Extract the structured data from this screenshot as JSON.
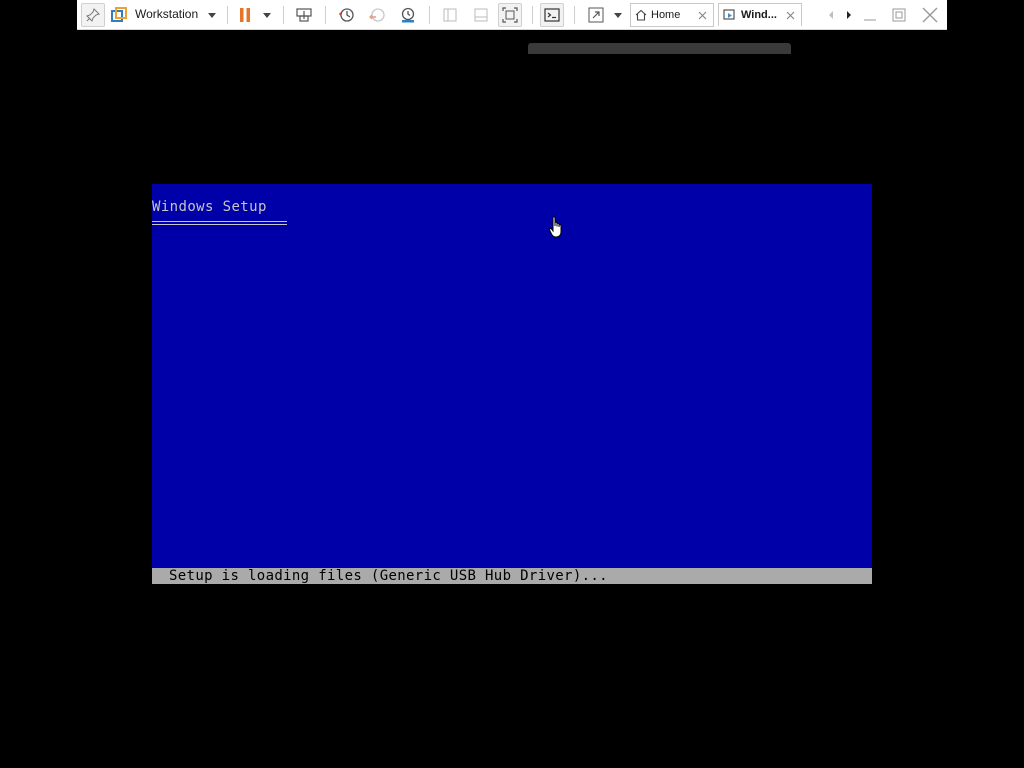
{
  "toolbar": {
    "workstation_label": "Workstation",
    "icons": {
      "pin": "pin-icon",
      "vmware_logo": "vmware-logo-icon",
      "pause": "pause-icon",
      "send_keys": "send-keys-icon",
      "snapshot": "snapshot-icon",
      "revert_snapshot": "revert-snapshot-icon",
      "snapshot_manager": "snapshot-manager-icon",
      "library": "library-icon",
      "thumbnail_bar": "thumbnail-bar-icon",
      "fit_guest": "fit-guest-icon",
      "console": "console-icon",
      "fullscreen": "fullscreen-icon"
    },
    "colors": {
      "pause": "#e8742a",
      "vmware_logo": "#2e7fc1",
      "tab_icon": "#3c8fd0"
    }
  },
  "tabs": [
    {
      "label": "Home",
      "icon": "home-icon",
      "active": false
    },
    {
      "label": "Wind...",
      "icon": "vm-icon",
      "active": true
    }
  ],
  "guest": {
    "title": "Windows Setup",
    "status": "Setup is loading files (Generic USB Hub Driver)...",
    "colors": {
      "background": "#0000a8",
      "status_bar": "#aaaaaa",
      "title_text": "#c6c6c6"
    }
  }
}
